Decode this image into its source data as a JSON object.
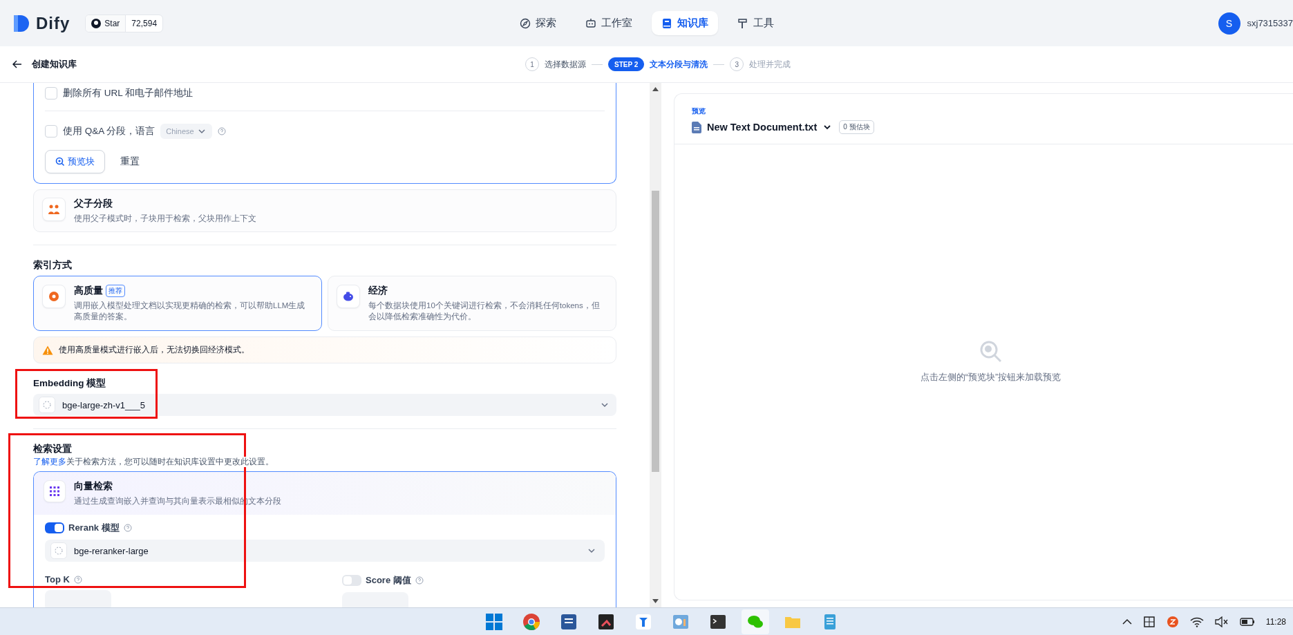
{
  "header": {
    "logo": "Dify",
    "github": {
      "label": "Star",
      "count": "72,594"
    },
    "nav": [
      {
        "label": "探索",
        "selected": false
      },
      {
        "label": "工作室",
        "selected": false
      },
      {
        "label": "知识库",
        "selected": true
      },
      {
        "label": "工具",
        "selected": false
      }
    ],
    "user": {
      "initial": "S",
      "name": "sxj7315337"
    }
  },
  "steps_bar": {
    "title": "创建知识库",
    "steps": [
      {
        "badge": "1",
        "label": "选择数据源",
        "selected": false
      },
      {
        "badge": "STEP 2",
        "label": "文本分段与清洗",
        "selected": true
      },
      {
        "badge": "3",
        "label": "处理并完成",
        "selected": false
      }
    ]
  },
  "segment": {
    "options": [
      {
        "label": "删除所有 URL 和电子邮件地址",
        "checked": false
      }
    ],
    "qa": {
      "label": "使用 Q&A 分段，语言",
      "checked": false,
      "language": "Chinese"
    },
    "preview_button": "预览块",
    "reset_button": "重置"
  },
  "parent_child": {
    "title": "父子分段",
    "description": "使用父子模式时，子块用于检索，父块用作上下文"
  },
  "index_method": {
    "title": "索引方式",
    "options": [
      {
        "kind": "quality",
        "title": "高质量",
        "badge": "推荐",
        "description": "调用嵌入模型处理文档以实现更精确的检索，可以帮助LLM生成高质量的答案。",
        "selected": true
      },
      {
        "kind": "economy",
        "title": "经济",
        "description": "每个数据块使用10个关键词进行检索，不会消耗任何tokens，但会以降低检索准确性为代价。",
        "selected": false
      }
    ],
    "warning": "使用高质量模式进行嵌入后，无法切换回经济模式。"
  },
  "embedding": {
    "label": "Embedding 模型",
    "value": "bge-large-zh-v1___5"
  },
  "retrieval": {
    "title": "检索设置",
    "link": "了解更多",
    "note": "关于检索方法，您可以随时在知识库设置中更改此设置。",
    "method": {
      "title": "向量检索",
      "description": "通过生成查询嵌入并查询与其向量表示最相似的文本分段"
    },
    "rerank": {
      "label": "Rerank 模型",
      "on": true,
      "value": "bge-reranker-large"
    },
    "top_k": {
      "label": "Top K"
    },
    "score": {
      "label": "Score 阈值",
      "on": false
    }
  },
  "preview": {
    "label": "预览",
    "file": "New Text Document.txt",
    "badge": "0 预估块",
    "empty_text": "点击左侧的“预览块”按钮来加载预览"
  },
  "taskbar": {
    "time": "11:28"
  }
}
